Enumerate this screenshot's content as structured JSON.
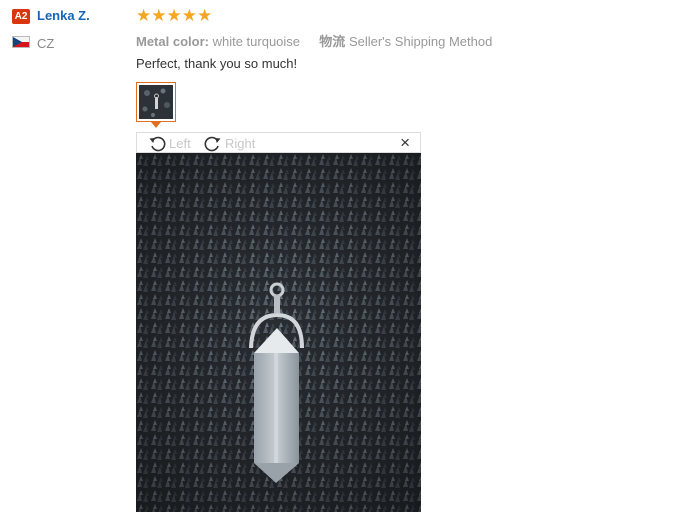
{
  "reviewer": {
    "level_badge": "A2",
    "name": "Lenka Z.",
    "country_code": "CZ",
    "flag_icon": "czech-flag-icon"
  },
  "review": {
    "stars": "★★★★★",
    "rating": 5,
    "attribute_key": "Metal color:",
    "attribute_value": "white turquoise",
    "shipping_prefix": "物流",
    "shipping_value": "Seller's Shipping Method",
    "comment": "Perfect, thank you so much!"
  },
  "viewer": {
    "rotate_left_label": "Left",
    "rotate_right_label": "Right",
    "close_label": "×"
  },
  "colors": {
    "badge": "#d9350f",
    "name_link": "#1766b5",
    "stars": "#f5a623",
    "thumb_border": "#e07020"
  }
}
